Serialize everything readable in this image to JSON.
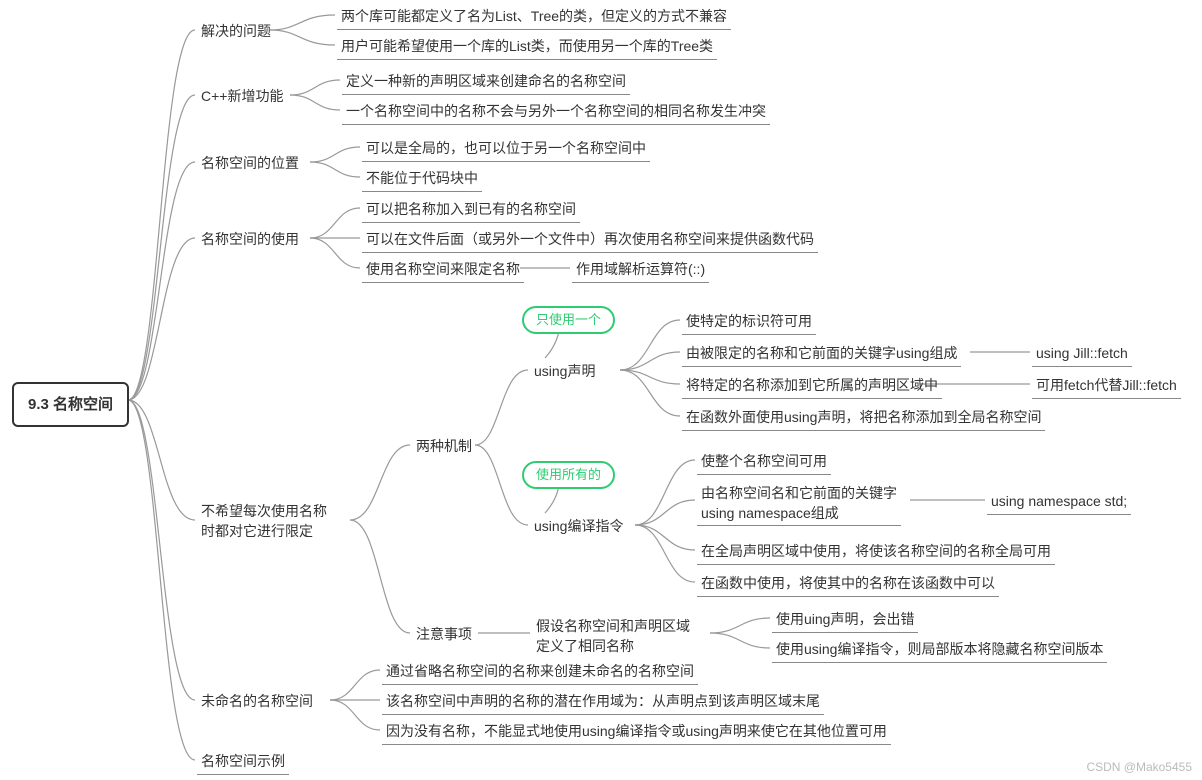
{
  "root": "9.3 名称空间",
  "b1": {
    "label": "解决的问题",
    "c1": "两个库可能都定义了名为List、Tree的类，但定义的方式不兼容",
    "c2": "用户可能希望使用一个库的List类，而使用另一个库的Tree类"
  },
  "b2": {
    "label": "C++新增功能",
    "c1": "定义一种新的声明区域来创建命名的名称空间",
    "c2": "一个名称空间中的名称不会与另外一个名称空间的相同名称发生冲突"
  },
  "b3": {
    "label": "名称空间的位置",
    "c1": "可以是全局的，也可以位于另一个名称空间中",
    "c2": "不能位于代码块中"
  },
  "b4": {
    "label": "名称空间的使用",
    "c1": "可以把名称加入到已有的名称空间",
    "c2": "可以在文件后面（或另外一个文件中）再次使用名称空间来提供函数代码",
    "c3": "使用名称空间来限定名称",
    "c3b": "作用域解析运算符(::)"
  },
  "b5": {
    "label": "不希望每次使用名称\n时都对它进行限定",
    "mech": {
      "label": "两种机制",
      "decl": {
        "bubble": "只使用一个",
        "label": "using声明",
        "c1": "使特定的标识符可用",
        "c2": "由被限定的名称和它前面的关键字using组成",
        "c2b": "using Jill::fetch",
        "c3": "将特定的名称添加到它所属的声明区域中",
        "c3b": "可用fetch代替Jill::fetch",
        "c4": "在函数外面使用using声明，将把名称添加到全局名称空间"
      },
      "dir": {
        "bubble": "使用所有的",
        "label": "using编译指令",
        "c1": "使整个名称空间可用",
        "c2": "由名称空间名和它前面的关键字\nusing namespace组成",
        "c2b": "using namespace std;",
        "c3": "在全局声明区域中使用，将使该名称空间的名称全局可用",
        "c4": "在函数中使用，将使其中的名称在该函数中可以"
      }
    },
    "note": {
      "label": "注意事项",
      "c1": "假设名称空间和声明区域\n定义了相同名称",
      "c1a": "使用uing声明，会出错",
      "c1b": "使用using编译指令，则局部版本将隐藏名称空间版本"
    }
  },
  "b6": {
    "label": "未命名的名称空间",
    "c1": "通过省略名称空间的名称来创建未命名的名称空间",
    "c2": "该名称空间中声明的名称的潜在作用域为：从声明点到该声明区域末尾",
    "c3": "因为没有名称，不能显式地使用using编译指令或using声明来使它在其他位置可用"
  },
  "b7": {
    "label": "名称空间示例"
  },
  "watermark": "CSDN @Mako5455"
}
